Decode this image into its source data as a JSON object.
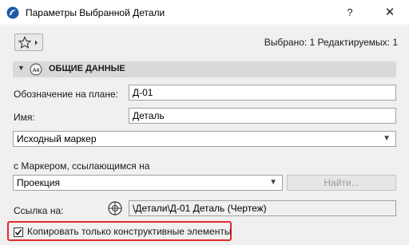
{
  "window": {
    "title": "Параметры Выбранной Детали",
    "help_label": "?",
    "close_label": "✕"
  },
  "toolbar": {
    "favorites_icon": "star-icon",
    "selected_info": "Выбрано: 1 Редактируемых: 1"
  },
  "section": {
    "title": "ОБЩИЕ ДАННЫЕ",
    "badge_icon": "section-badge-icon"
  },
  "fields": {
    "plan_id_label": "Обозначение на плане:",
    "plan_id_value": "Д-01",
    "name_label": "Имя:",
    "name_value": "Деталь",
    "marker_value": "Исходный маркер",
    "ref_marker_label": "с Маркером, ссылающимся на",
    "ref_marker_value": "Проекция",
    "find_button": "Найти...",
    "link_label": "Ссылка на:",
    "link_value": "\\Детали\\Д-01 Деталь (Чертеж)"
  },
  "checkbox": {
    "label": "Копировать только конструктивные элементы",
    "checked": true
  },
  "colors": {
    "highlight": "#e02b2b",
    "section_bg": "#d9d9d9",
    "dialog_bg": "#f0f0f0"
  }
}
